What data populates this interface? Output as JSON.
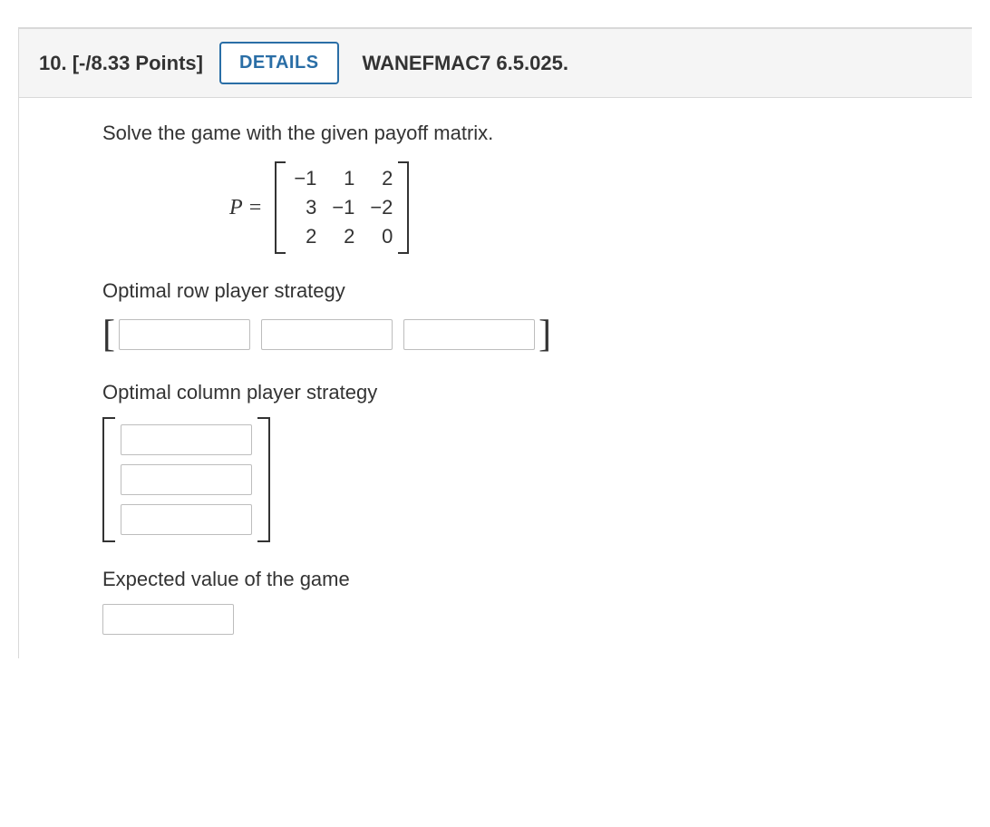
{
  "header": {
    "number": "10.",
    "points": "[-/8.33 Points]",
    "details_label": "DETAILS",
    "source": "WANEFMAC7 6.5.025."
  },
  "body": {
    "prompt": "Solve the game with the given payoff matrix.",
    "matrix_label": "P =",
    "matrix": [
      [
        "−1",
        "1",
        "2"
      ],
      [
        "3",
        "−1",
        "−2"
      ],
      [
        "2",
        "2",
        "0"
      ]
    ],
    "row_label": "Optimal row player strategy",
    "col_label": "Optimal column player strategy",
    "ev_label": "Expected value of the game",
    "row_values": [
      "",
      "",
      ""
    ],
    "col_values": [
      "",
      "",
      ""
    ],
    "ev_value": ""
  }
}
